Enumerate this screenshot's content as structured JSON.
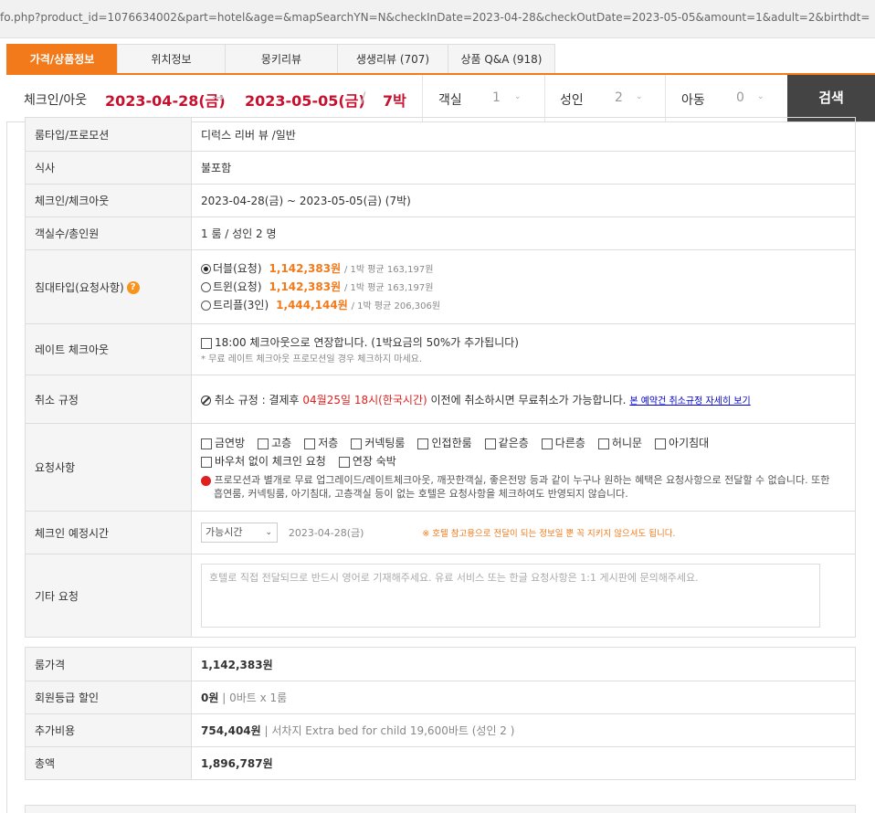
{
  "url": "fo.php?product_id=1076634002&part=hotel&age=&mapSearchYN=N&checkInDate=2023-04-28&checkOutDate=2023-05-05&amount=1&adult=2&birthdt=",
  "tabs": [
    {
      "label": "가격/상품정보"
    },
    {
      "label": "위치정보"
    },
    {
      "label": "몽키리뷰"
    },
    {
      "label": "생생리뷰 (707)"
    },
    {
      "label": "상품 Q&A (918)"
    }
  ],
  "search": {
    "checkin_label": "체크인/아웃",
    "checkin_date": "2023-04-28(금)",
    "arrow": "→",
    "checkout_date": "2023-05-05(금)",
    "slash": "/",
    "nights": "7박",
    "rooms_label": "객실",
    "rooms_value": "1",
    "adults_label": "성인",
    "adults_value": "2",
    "children_label": "아동",
    "children_value": "0",
    "search_button": "검색"
  },
  "details": {
    "roomtype_label": "룸타입/프로모션",
    "roomtype_value": "디럭스 리버 뷰 /일반",
    "meal_label": "식사",
    "meal_value": "불포함",
    "checkinout_label": "체크인/체크아웃",
    "checkinout_value": "2023-04-28(금) ~ 2023-05-05(금) (7박)",
    "guests_label": "객실수/총인원",
    "guests_value": "1 룸 / 성인 2 명",
    "bed_label": "침대타입(요청사항)",
    "bed_help": "?",
    "bed_options": [
      {
        "name": "더블(요청)",
        "price": "1,142,383원",
        "avg": "/ 1박 평균 163,197원",
        "selected": true
      },
      {
        "name": "트윈(요청)",
        "price": "1,142,383원",
        "avg": "/ 1박 평균 163,197원",
        "selected": false
      },
      {
        "name": "트리플(3인)",
        "price": "1,444,144원",
        "avg": "/ 1박 평균 206,306원",
        "selected": false
      }
    ],
    "late_label": "레이트 체크아웃",
    "late_option": "18:00 체크아웃으로 연장합니다. (1박요금의 50%가 추가됩니다)",
    "late_note": "* 무료 레이트 체크아웃 프로모션일 경우 체크하지 마세요.",
    "cancel_label": "취소 규정",
    "cancel_prefix": "취소 규정 : 결제후 ",
    "cancel_deadline": "04월25일 18시(한국시간)",
    "cancel_suffix": " 이전에 취소하시면 무료취소가 가능합니다.",
    "cancel_link": "본 예약건 취소규정 자세히 보기",
    "request_label": "요청사항",
    "request_options_row1": [
      "금연방",
      "고층",
      "저층",
      "커넥팅룸",
      "인접한룸",
      "같은층",
      "다른층",
      "허니문",
      "아기침대"
    ],
    "request_options_row2": [
      "바우처 없이 체크인 요청",
      "연장 숙박"
    ],
    "request_note": "프로모션과 별개로 무료 업그레이드/레이트체크아웃, 깨끗한객실, 좋은전망 등과 같이 누구나 원하는 혜택은 요청사항으로 전달할 수 없습니다. 또한 흡연룸, 커넥팅룸, 아기침대, 고층객실 등이 없는 호텔은 요청사항을 체크하여도 반영되지 않습니다.",
    "warn_icon": "!",
    "eta_label": "체크인 예정시간",
    "eta_select": "가능시간",
    "eta_date": "2023-04-28(금)",
    "eta_note": "※ 호텔 참고용으로 전달이 되는 정보일 뿐 꼭 지키지 않으셔도 됩니다.",
    "other_label": "기타 요청",
    "other_placeholder": "호텔로 직접 전달되므로 반드시 영어로 기재해주세요. 유료 서비스 또는 한글 요청사항은 1:1 게시판에 문의해주세요."
  },
  "pricing": {
    "room_label": "룸가격",
    "room_value": "1,142,383원",
    "member_label": "회원등급 할인",
    "member_value": "0원",
    "member_detail": " | 0바트 x 1룸",
    "extra_label": "추가비용",
    "extra_value": "754,404원",
    "extra_detail": " | 서차지 Extra bed for child 19,600바트 (성인 2 )",
    "total_label": "총액",
    "total_value": "1,896,787원"
  },
  "colors": {
    "accent": "#f27a1a",
    "date_red": "#c8102e",
    "search_button": "#444444"
  }
}
